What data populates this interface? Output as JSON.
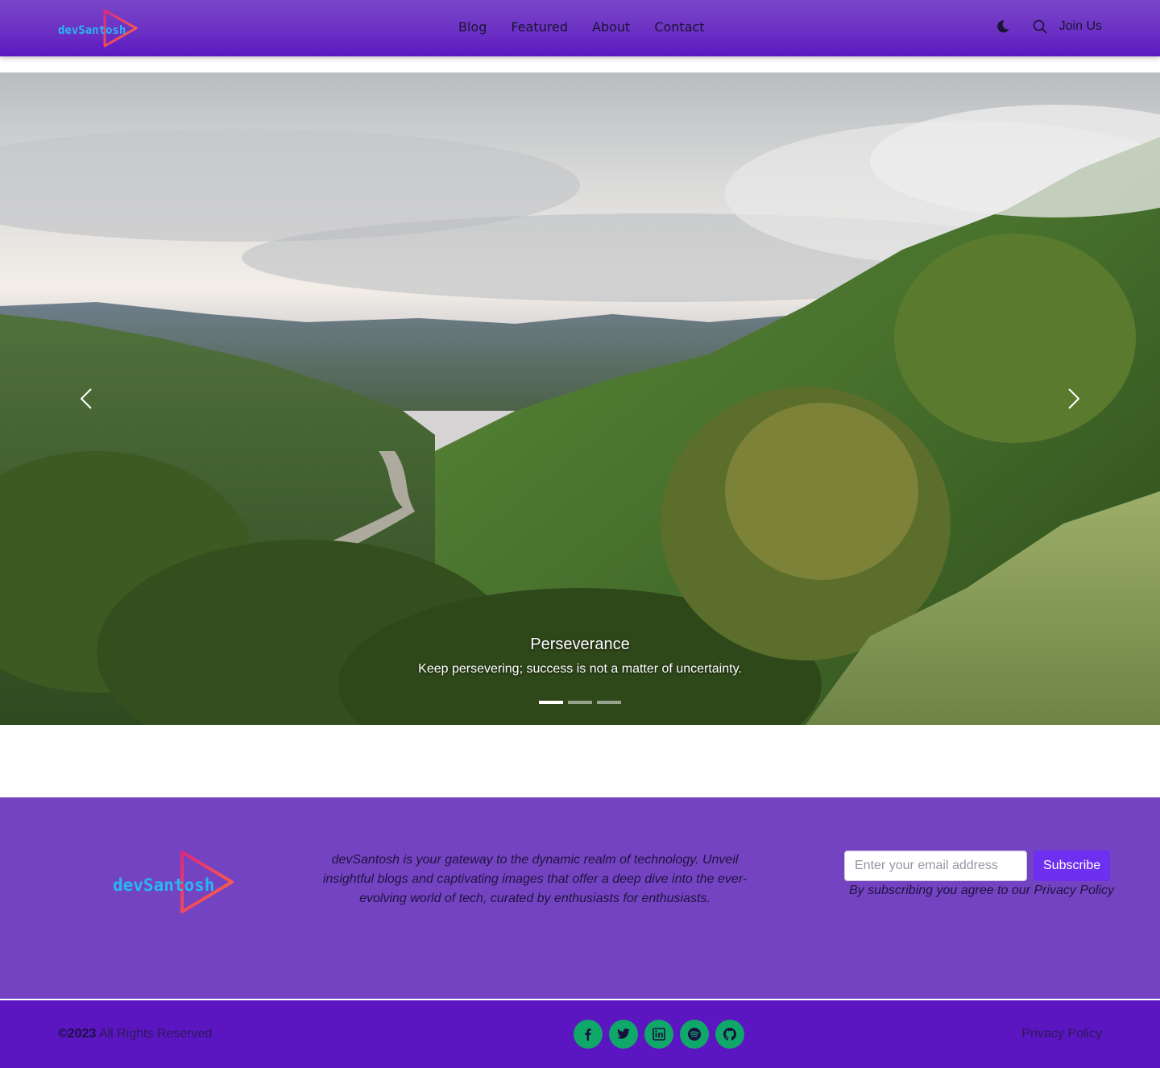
{
  "brand": {
    "name": "devSantosh"
  },
  "nav": {
    "links": [
      "Blog",
      "Featured",
      "About",
      "Contact"
    ],
    "join_label": "Join Us",
    "icons": [
      "moon-icon",
      "search-icon"
    ]
  },
  "hero": {
    "caption_title": "Perseverance",
    "caption_text": "Keep persevering; success is not a matter of uncertainty.",
    "slides": 3,
    "active_slide": 1
  },
  "footer": {
    "description": "devSantosh is your gateway to the dynamic realm of technology. Unveil insightful blogs and captivating images that offer a deep dive into the ever-evolving world of tech, curated by enthusiasts for enthusiasts.",
    "email_placeholder": "Enter your email address",
    "subscribe_label": "Subscribe",
    "subscribe_note": "By subscribing you agree to our Privacy Policy",
    "copyright_year": "©2023",
    "copyright_rest": " All Rights Reserved",
    "privacy_label": "Privacy Policy",
    "socials": [
      "facebook-icon",
      "twitter-icon",
      "linkedin-icon",
      "spotify-icon",
      "github-icon"
    ]
  },
  "colors": {
    "nav_bg": "#6a2fc4",
    "footer_bg": "#7443c2",
    "footer_bottom_bg": "#5b16c2",
    "social_bg": "#0fa86a",
    "subscribe_bg": "#6e2ff0",
    "logo_text": "#28b7f0",
    "logo_play": "#e0287a"
  }
}
